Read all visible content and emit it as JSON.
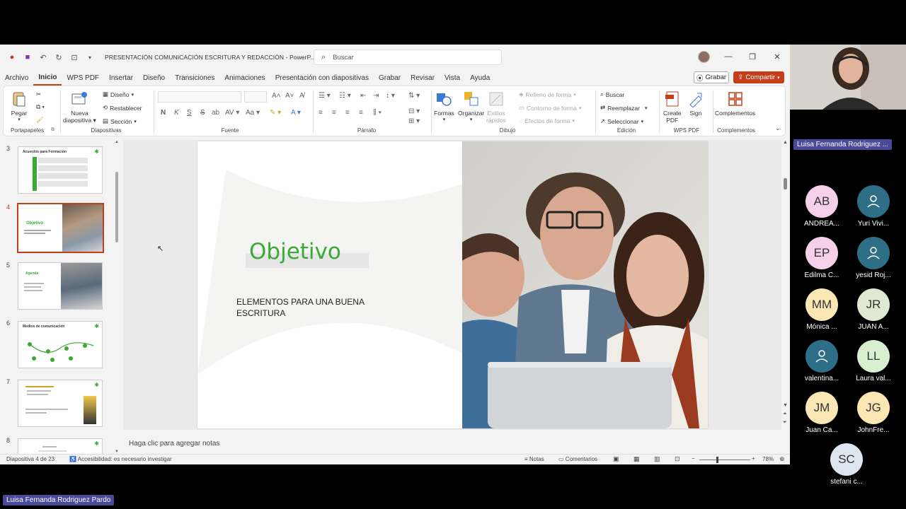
{
  "app": {
    "title": "PRESENTACIÓN COMUNICACIÓN  ESCRITURA Y REDACCIÓN  -  PowerP...",
    "search_placeholder": "Buscar"
  },
  "menu": {
    "items": [
      "Archivo",
      "Inicio",
      "WPS PDF",
      "Insertar",
      "Diseño",
      "Transiciones",
      "Animaciones",
      "Presentación con diapositivas",
      "Grabar",
      "Revisar",
      "Vista",
      "Ayuda"
    ],
    "active": "Inicio",
    "grabar_label": "Grabar",
    "compartir_label": "Compartir"
  },
  "ribbon": {
    "pegar": "Pegar",
    "nueva_diapositiva_1": "Nueva",
    "nueva_diapositiva_2": "diapositiva",
    "diseno": "Diseño",
    "restablecer": "Restablecer",
    "seccion": "Sección",
    "formas": "Formas",
    "organizar": "Organizar",
    "estilos_1": "Estilos",
    "estilos_2": "rápidos",
    "relleno": "Relleno de forma",
    "contorno": "Contorno de forma",
    "efectos": "Efectos de forma",
    "buscar": "Buscar",
    "reemplazar": "Reemplazar",
    "seleccionar": "Seleccionar",
    "create_pdf_1": "Create",
    "create_pdf_2": "PDF",
    "sign": "Sign",
    "complementos": "Complementos",
    "groups": {
      "portapapeles": "Portapapeles",
      "diapositivas": "Diapositivas",
      "fuente": "Fuente",
      "parrafo": "Párrafo",
      "dibujo": "Dibujo",
      "edicion": "Edición",
      "wps_pdf": "WPS PDF",
      "complementos": "Complementos"
    }
  },
  "thumbnails": [
    {
      "num": "3",
      "title": "Acuerdos para Formación"
    },
    {
      "num": "4",
      "title": "Objetivo",
      "selected": true
    },
    {
      "num": "5",
      "title": "Agenda"
    },
    {
      "num": "6",
      "title": "Medios de comunicación"
    },
    {
      "num": "7",
      "title": ""
    },
    {
      "num": "8",
      "title": ""
    }
  ],
  "slide": {
    "title": "Objetivo",
    "subtitle": "ELEMENTOS PARA UNA BUENA ESCRITURA",
    "accent_color": "#3aaa35"
  },
  "notes_placeholder": "Haga clic para agregar notas",
  "status": {
    "slide_count": "Diapositiva 4 de 23",
    "accessibility": "Accesibilidad: es necesario investigar",
    "notas": "Notas",
    "comentarios": "Comentarios",
    "zoom": "78%"
  },
  "meeting": {
    "speaker_name": "Luisa Fernanda Rodriguez ...",
    "presenter_full_name": "Luisa Fernanda Rodriguez Pardo",
    "participants": [
      {
        "initials": "AB",
        "name": "ANDREA...",
        "color": "#f6d0e8"
      },
      {
        "initials": "",
        "name": "Yuri Vivi...",
        "color": "#2e6e86",
        "icon": "person-icon"
      },
      {
        "initials": "EP",
        "name": "Edilma C...",
        "color": "#f6d0e8"
      },
      {
        "initials": "",
        "name": "yesid Roj...",
        "color": "#2e6e86",
        "icon": "person-icon"
      },
      {
        "initials": "MM",
        "name": "Mónica ...",
        "color": "#fbe7b4"
      },
      {
        "initials": "JR",
        "name": "JUAN A...",
        "color": "#dfe8d2"
      },
      {
        "initials": "",
        "name": "valentina...",
        "color": "#2e6e86",
        "icon": "person-icon"
      },
      {
        "initials": "LL",
        "name": "Laura val...",
        "color": "#d9f0d0"
      },
      {
        "initials": "JM",
        "name": "Juan Ca...",
        "color": "#fbe7b4"
      },
      {
        "initials": "JG",
        "name": "JohnFre...",
        "color": "#fbe7b4"
      },
      {
        "initials": "SC",
        "name": "stefani c...",
        "color": "#dde6ef"
      }
    ]
  }
}
